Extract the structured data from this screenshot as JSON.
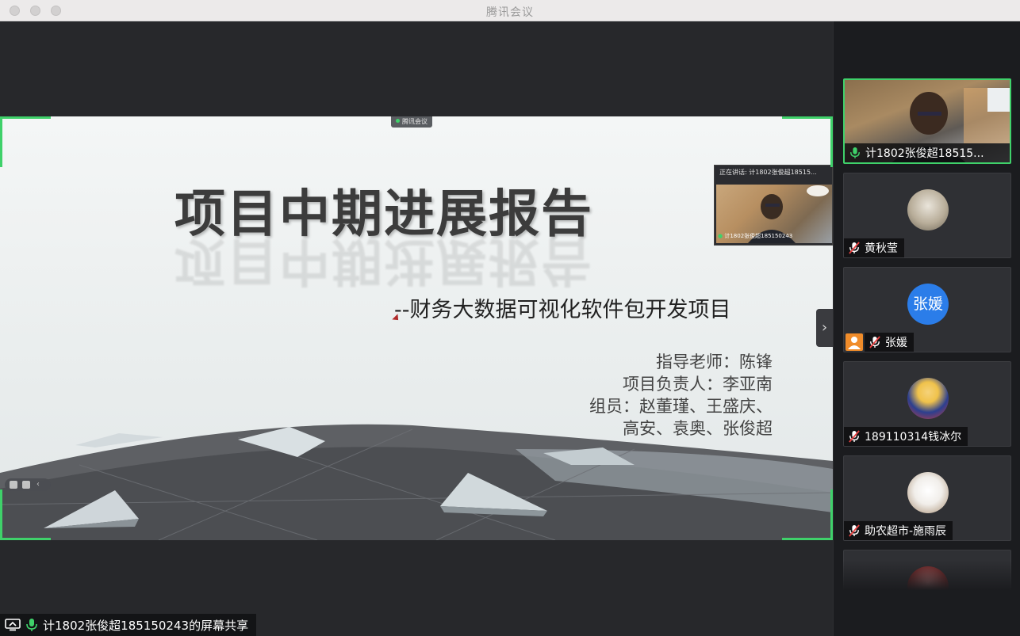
{
  "window": {
    "title": "腾讯会议",
    "traffic_lights": [
      "close",
      "minimize",
      "zoom"
    ]
  },
  "slide": {
    "tag": "腾讯会议",
    "title": "项目中期进展报告",
    "subtitle": "--财务大数据可视化软件包开发项目",
    "info_lines": [
      "指导老师：陈锋",
      "项目负责人：李亚南",
      "组员：赵董瑾、王盛庆、",
      "高安、袁奥、张俊超"
    ]
  },
  "speaker_float": {
    "label": "正在讲话: 计1802张俊超18515...",
    "caption": "计1802张俊超185150243"
  },
  "share_bar": {
    "text": "计1802张俊超185150243的屏幕共享"
  },
  "participants": [
    {
      "name": "计1802张俊超18515...",
      "type": "video",
      "mic": "on",
      "active": true
    },
    {
      "name": "黄秋莹",
      "type": "avatar-image",
      "mic": "muted"
    },
    {
      "name": "张媛",
      "type": "avatar-text",
      "avatar_text": "张媛",
      "mic": "muted",
      "extra_badge": "person-icon"
    },
    {
      "name": "189110314钱冰尔",
      "type": "avatar-image",
      "mic": "muted"
    },
    {
      "name": "助农超市-施雨辰",
      "type": "avatar-image",
      "mic": "muted"
    },
    {
      "name": "",
      "type": "avatar-image",
      "mic": "muted"
    }
  ],
  "colors": {
    "accent_green": "#3fd16a",
    "avatar_blue": "#2b7de9",
    "badge_orange": "#f08c2a"
  }
}
